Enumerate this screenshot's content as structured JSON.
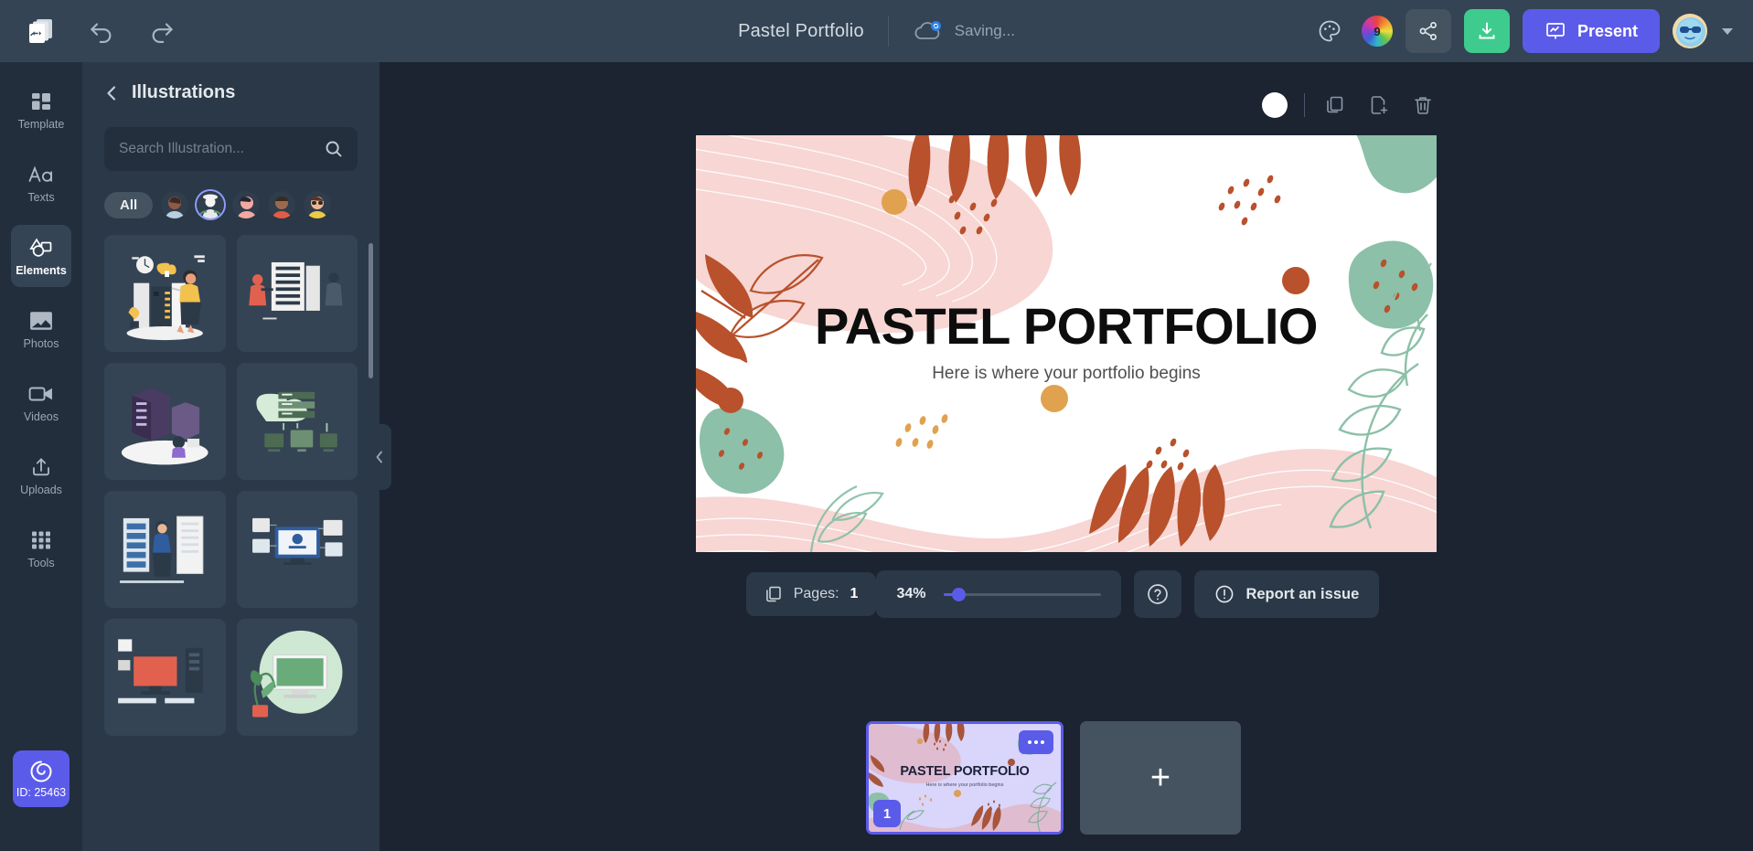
{
  "topbar": {
    "logo_icon": "slides-logo-icon",
    "undo_icon": "undo-icon",
    "redo_icon": "redo-icon",
    "document_title": "Pastel Portfolio",
    "save_status": "Saving...",
    "cloud_icon": "cloud-sync-icon",
    "palette_icon": "palette-icon",
    "color_badge_count": "9",
    "share_icon": "share-icon",
    "download_icon": "download-icon",
    "present_label": "Present",
    "present_icon": "presentation-screen-icon",
    "avatar_name": "user-avatar",
    "caret_icon": "chevron-down-icon"
  },
  "rail": {
    "items": [
      {
        "label": "Template",
        "icon": "template-grid-icon",
        "active": false
      },
      {
        "label": "Texts",
        "icon": "text-aa-icon",
        "active": false
      },
      {
        "label": "Elements",
        "icon": "shapes-icon",
        "active": true
      },
      {
        "label": "Photos",
        "icon": "photo-icon",
        "active": false
      },
      {
        "label": "Videos",
        "icon": "video-camera-icon",
        "active": false
      },
      {
        "label": "Uploads",
        "icon": "upload-icon",
        "active": false
      },
      {
        "label": "Tools",
        "icon": "grid-dots-icon",
        "active": false
      }
    ],
    "id_badge": {
      "label": "ID: 25463",
      "icon": "spiral-icon"
    }
  },
  "panel": {
    "back_icon": "chevron-left-icon",
    "title": "Illustrations",
    "search": {
      "value": "",
      "placeholder": "Search Illustration...",
      "icon": "search-icon"
    },
    "chips": {
      "all_label": "All",
      "avatars": [
        {
          "name": "avatar-filter-1",
          "selected": false
        },
        {
          "name": "avatar-filter-2",
          "selected": true
        },
        {
          "name": "avatar-filter-3",
          "selected": false
        },
        {
          "name": "avatar-filter-4",
          "selected": false
        },
        {
          "name": "avatar-filter-5",
          "selected": false
        }
      ]
    },
    "thumbnails": [
      {
        "name": "illustration-server-room-woman"
      },
      {
        "name": "illustration-server-rack-people"
      },
      {
        "name": "illustration-data-center-isometric"
      },
      {
        "name": "illustration-cloud-servers-green"
      },
      {
        "name": "illustration-server-technician"
      },
      {
        "name": "illustration-desktop-monitors"
      },
      {
        "name": "illustration-workstation-red"
      },
      {
        "name": "illustration-imac-plant-green"
      }
    ],
    "collapse_icon": "chevron-left-icon"
  },
  "canvas": {
    "toolbar": {
      "background_swatch_color": "#ffffff",
      "duplicate_icon": "duplicate-page-icon",
      "add_page_icon": "add-page-icon",
      "delete_icon": "trash-icon"
    },
    "slide": {
      "title": "PASTEL PORTFOLIO",
      "subtitle": "Here is where your portfolio begins",
      "background": "#ffffff",
      "palette": {
        "pink": "#f6d4d2",
        "terracotta": "#b85c2e",
        "sage": "#8fc0ab",
        "orange": "#e9a54d",
        "title_color": "#0d0d0d",
        "subtitle_color": "#4f4f4f"
      }
    }
  },
  "controls": {
    "pages_label": "Pages:",
    "pages_count": "1",
    "pages_icon": "layers-icon",
    "zoom_value": "34%",
    "zoom_percent": 34,
    "help_icon": "question-circle-icon",
    "report_label": "Report an issue",
    "report_icon": "alert-circle-icon"
  },
  "filmstrip": {
    "slides": [
      {
        "number": "1",
        "title": "PASTEL PORTFOLIO",
        "subtitle": "Here is where your portfolio begins",
        "selected": true,
        "menu_icon": "more-options-icon"
      }
    ],
    "add_slide_label": "+",
    "add_slide_icon": "plus-icon"
  }
}
